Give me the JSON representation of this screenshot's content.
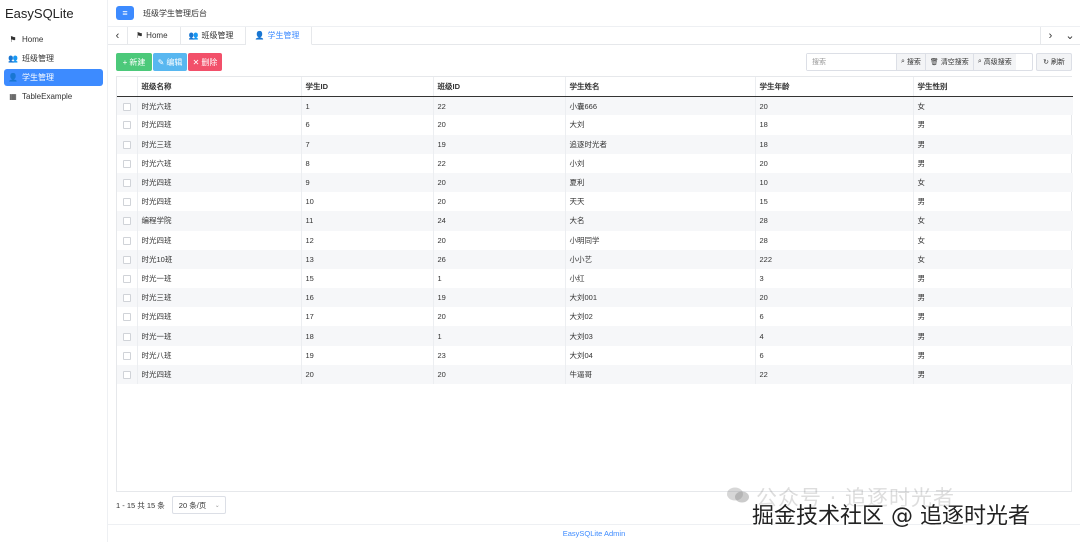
{
  "app": {
    "brand": "EasySQLite",
    "header_title": "班级学生管理后台"
  },
  "sidebar": {
    "items": [
      {
        "label": "Home",
        "icon": "flag-icon",
        "glyph": "⚑",
        "active": false
      },
      {
        "label": "班级管理",
        "icon": "users-icon",
        "glyph": "👥",
        "active": false
      },
      {
        "label": "学生管理",
        "icon": "user-group-icon",
        "glyph": "👤",
        "active": true
      },
      {
        "label": "TableExample",
        "icon": "table-icon",
        "glyph": "▦",
        "active": false
      }
    ]
  },
  "tabs": [
    {
      "label": "Home",
      "glyph": "⚑",
      "active": false
    },
    {
      "label": "班级管理",
      "glyph": "👥",
      "active": false
    },
    {
      "label": "学生管理",
      "glyph": "👤",
      "active": true
    }
  ],
  "toolbar": {
    "new_label": "新建",
    "edit_label": "编辑",
    "delete_label": "删除",
    "search_placeholder": "搜索",
    "search_label": "搜索",
    "clear_label": "清空搜索",
    "advanced_label": "高级搜索",
    "refresh_label": "刷新"
  },
  "table": {
    "columns": [
      "班级名称",
      "学生ID",
      "班级ID",
      "学生姓名",
      "学生年龄",
      "学生性别"
    ],
    "rows": [
      [
        "时光六班",
        "1",
        "22",
        "小囊666",
        "20",
        "女"
      ],
      [
        "时光四班",
        "6",
        "20",
        "大刘",
        "18",
        "男"
      ],
      [
        "时光三班",
        "7",
        "19",
        "追逐时光者",
        "18",
        "男"
      ],
      [
        "时光六班",
        "8",
        "22",
        "小刘",
        "20",
        "男"
      ],
      [
        "时光四班",
        "9",
        "20",
        "夏利",
        "10",
        "女"
      ],
      [
        "时光四班",
        "10",
        "20",
        "天天",
        "15",
        "男"
      ],
      [
        "编程学院",
        "11",
        "24",
        "大名",
        "28",
        "女"
      ],
      [
        "时光四班",
        "12",
        "20",
        "小明同学",
        "28",
        "女"
      ],
      [
        "时光10班",
        "13",
        "26",
        "小小艺",
        "222",
        "女"
      ],
      [
        "时光一班",
        "15",
        "1",
        "小红",
        "3",
        "男"
      ],
      [
        "时光三班",
        "16",
        "19",
        "大刘001",
        "20",
        "男"
      ],
      [
        "时光四班",
        "17",
        "20",
        "大刘02",
        "6",
        "男"
      ],
      [
        "时光一班",
        "18",
        "1",
        "大刘03",
        "4",
        "男"
      ],
      [
        "时光八班",
        "19",
        "23",
        "大刘04",
        "6",
        "男"
      ],
      [
        "时光四班",
        "20",
        "20",
        "牛逼哥",
        "22",
        "男"
      ]
    ]
  },
  "pagination": {
    "summary": "1 - 15 共 15 条",
    "page_size": "20 条/页"
  },
  "footer": {
    "text": "EasySQLite Admin"
  },
  "watermark": {
    "line1": "公众号 · 追逐时光者",
    "line2": "掘金技术社区 @ 追逐时光者"
  }
}
